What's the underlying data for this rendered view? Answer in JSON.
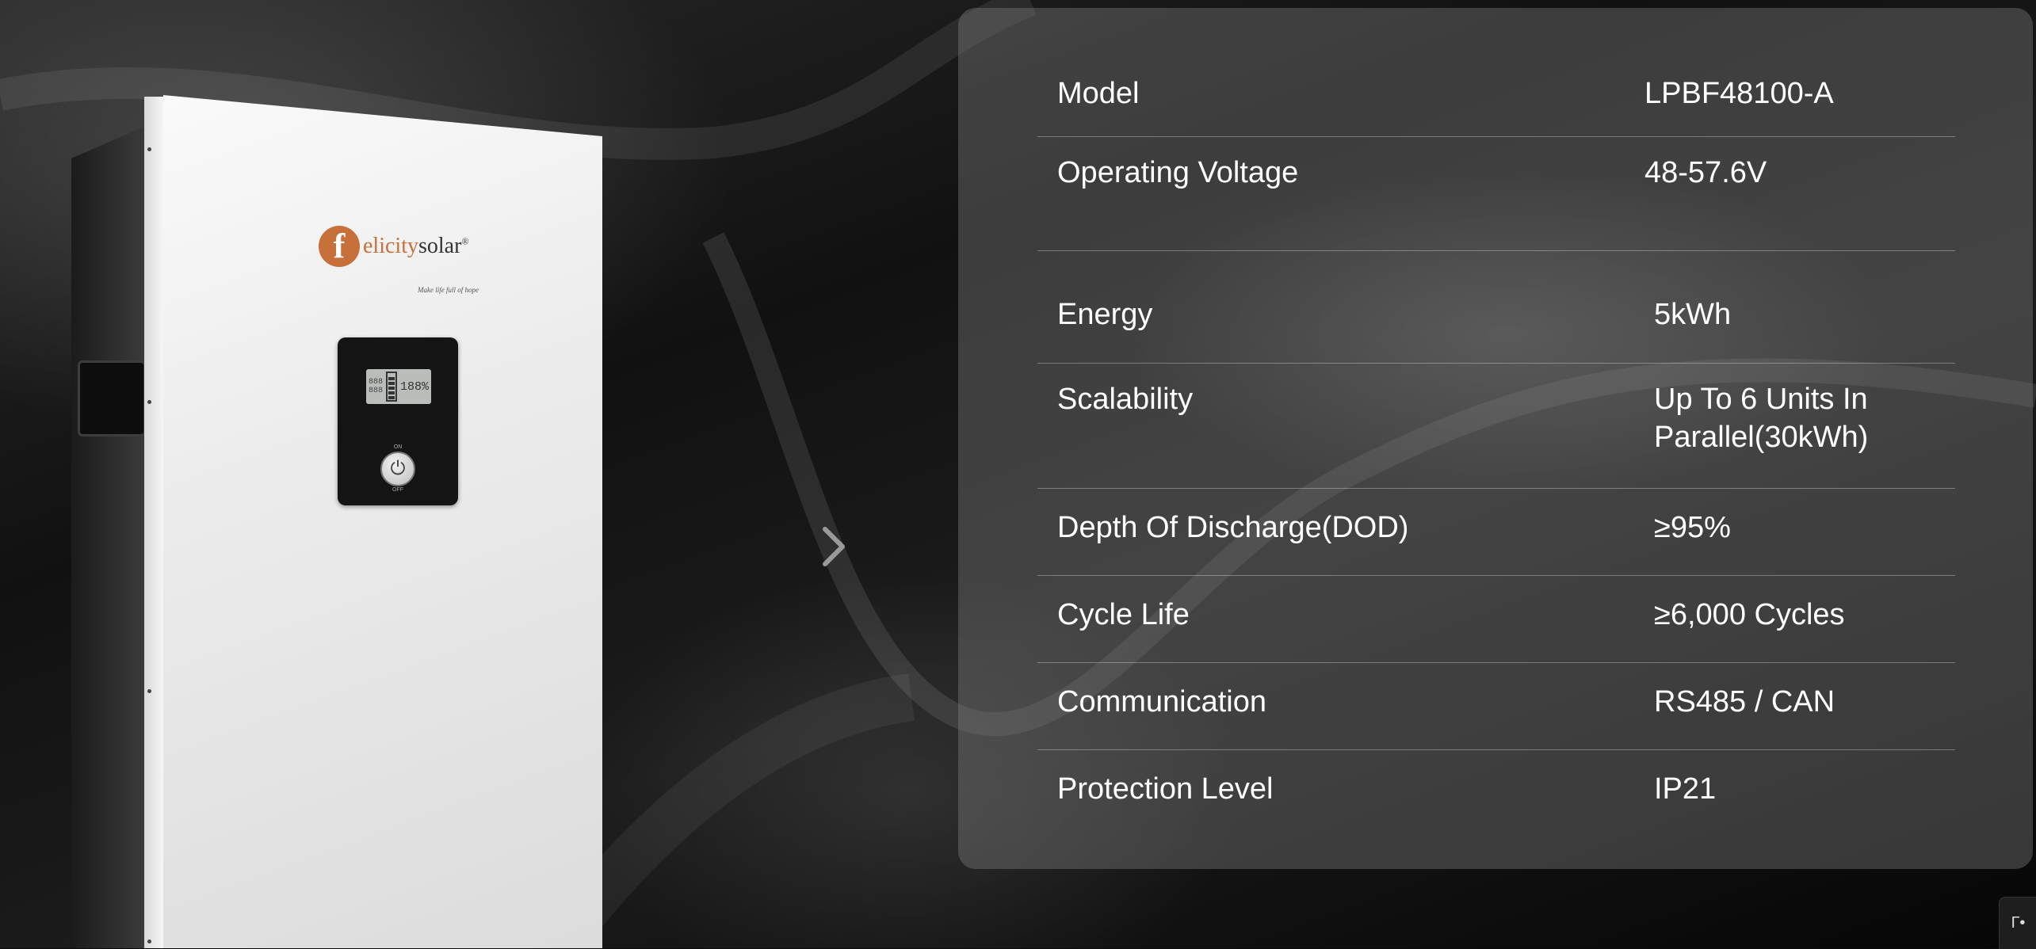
{
  "brand": {
    "logo_letter": "f",
    "name_part1": "elicity",
    "name_part2": "solar",
    "registered_mark": "®",
    "tagline": "Make life full of hope"
  },
  "device_panel": {
    "lcd_readout": "188%",
    "lcd_digits_top": "888",
    "lcd_digits_bottom": "888",
    "on_label": "ON",
    "off_label": "OFF"
  },
  "carousel": {
    "next_icon": "chevron-right-icon"
  },
  "specs": [
    {
      "label": "Model",
      "value": "LPBF48100-A"
    },
    {
      "label": "Operating Voltage",
      "value": "48-57.6V"
    },
    {
      "label": "Energy",
      "value": "5kWh"
    },
    {
      "label": "Scalability",
      "value": "Up To 6 Units In Parallel(30kWh)"
    },
    {
      "label": "Depth Of Discharge(DOD)",
      "value": "≥95%"
    },
    {
      "label": "Cycle Life",
      "value": "≥6,000 Cycles"
    },
    {
      "label": "Communication",
      "value": "RS485 / CAN"
    },
    {
      "label": "Protection Level",
      "value": "IP21"
    }
  ],
  "corner_widget": {
    "text": "Г•"
  },
  "colors": {
    "brand_orange": "#c8703a",
    "card_bg": "rgba(128,128,128,0.40)",
    "text": "#ffffff"
  }
}
